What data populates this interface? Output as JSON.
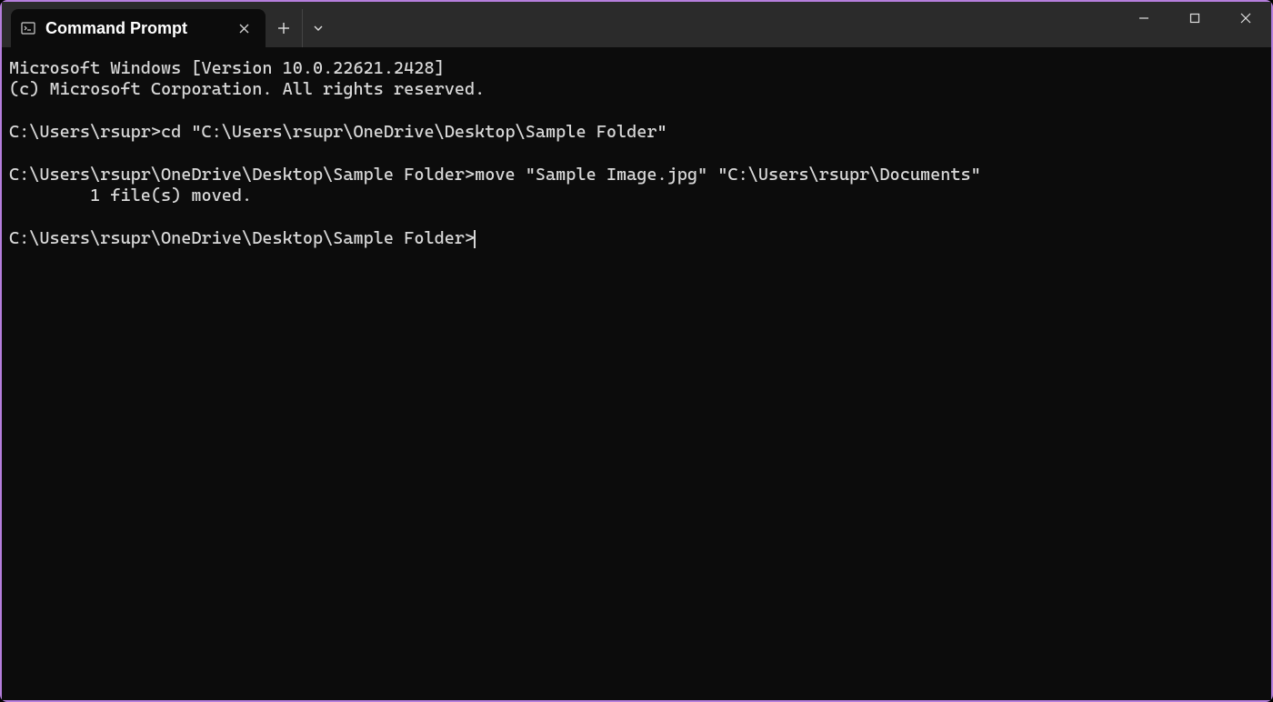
{
  "titlebar": {
    "tab_title": "Command Prompt"
  },
  "terminal": {
    "lines": [
      "Microsoft Windows [Version 10.0.22621.2428]",
      "(c) Microsoft Corporation. All rights reserved.",
      "",
      "C:\\Users\\rsupr>cd \"C:\\Users\\rsupr\\OneDrive\\Desktop\\Sample Folder\"",
      "",
      "C:\\Users\\rsupr\\OneDrive\\Desktop\\Sample Folder>move \"Sample Image.jpg\" \"C:\\Users\\rsupr\\Documents\"",
      "        1 file(s) moved.",
      "",
      "C:\\Users\\rsupr\\OneDrive\\Desktop\\Sample Folder>"
    ]
  }
}
